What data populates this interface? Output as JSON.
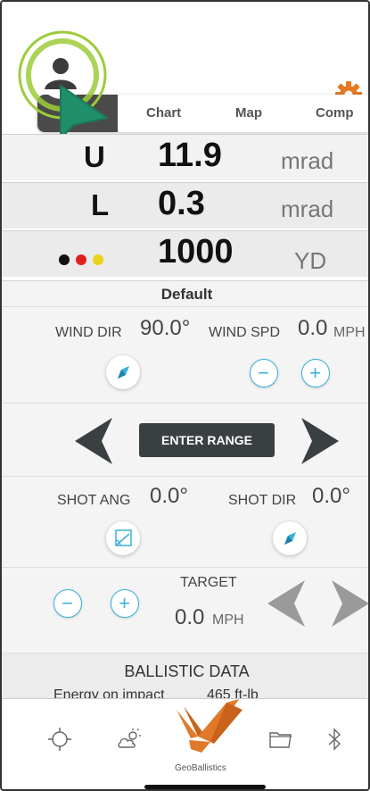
{
  "tabs": {
    "chart": "Chart",
    "map": "Map",
    "comp": "Comp"
  },
  "readouts": {
    "up": {
      "label": "U",
      "value": "11.9",
      "unit": "mrad"
    },
    "left": {
      "label": "L",
      "value": "0.3",
      "unit": "mrad"
    },
    "range": {
      "value": "1000",
      "unit": "YD",
      "dot_colors": [
        "#111111",
        "#e0201f",
        "#e8d21a"
      ]
    }
  },
  "profile_name": "Default",
  "wind": {
    "dir_label": "WIND DIR",
    "dir_value": "90.0°",
    "spd_label": "WIND SPD",
    "spd_value": "0.0",
    "spd_unit": "MPH",
    "minus": "−",
    "plus": "+"
  },
  "range_entry": {
    "button": "ENTER RANGE"
  },
  "shot": {
    "ang_label": "SHOT ANG",
    "ang_value": "0.0°",
    "dir_label": "SHOT DIR",
    "dir_value": "0.0°"
  },
  "target": {
    "label": "TARGET",
    "value": "0.0",
    "unit": "MPH",
    "minus": "−",
    "plus": "+"
  },
  "ballistic": {
    "title": "BALLISTIC DATA",
    "energy_label": "Energy on impact",
    "energy_value": "465 ft-lb"
  },
  "bottom_nav": {
    "brand": "GeoBallistics"
  },
  "colors": {
    "accent": "#3ab0d8",
    "brand": "#e07a2a",
    "cursor": "#1f8f6a",
    "rings": "#9ccc3a"
  }
}
